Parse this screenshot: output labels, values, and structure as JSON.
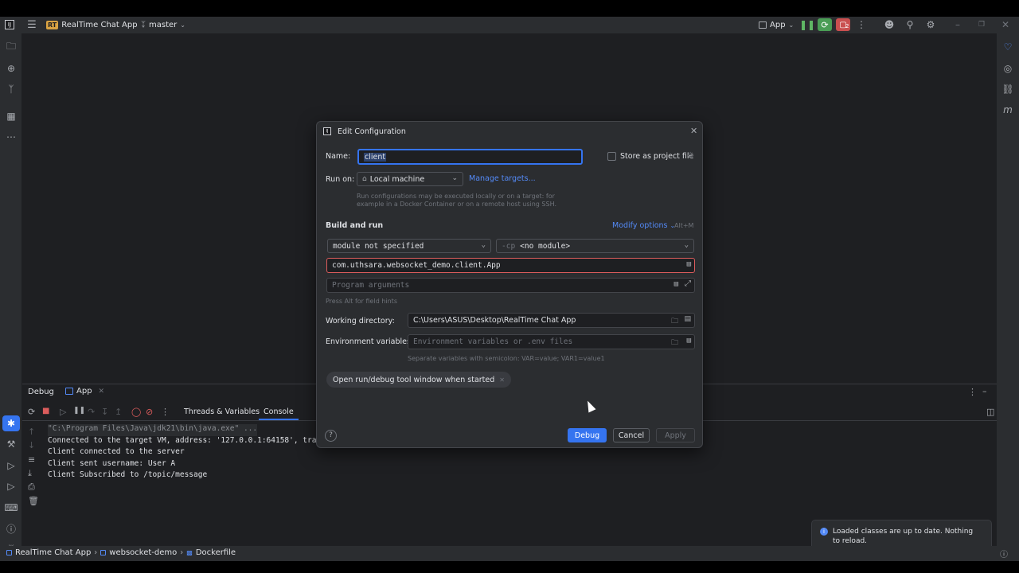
{
  "titlebar": {
    "project_badge": "RT",
    "project_name": "RealTime Chat App",
    "branch": "master",
    "run_config": "App",
    "stop_count": "2"
  },
  "debug_panel": {
    "tab_debug": "Debug",
    "tab_app": "App",
    "tab_threads": "Threads & Variables",
    "tab_console": "Console",
    "console_lines": [
      "\"C:\\Program Files\\Java\\jdk21\\bin\\java.exe\" ...",
      "Connected to the target VM, address: '127.0.0.1:64158', transpo",
      "Client connected to the server",
      "Client sent username: User A",
      "Client Subscribed to /topic/message"
    ]
  },
  "statusbar": {
    "crumbs": [
      "RealTime Chat App",
      "websocket-demo",
      "Dockerfile"
    ]
  },
  "notification": {
    "text": "Loaded classes are up to date. Nothing to reload."
  },
  "dialog": {
    "title": "Edit Configuration",
    "name_label": "Name:",
    "name_value": "client",
    "store_label": "Store as project file",
    "run_on_label": "Run on:",
    "run_on_value": "Local machine",
    "manage_targets": "Manage targets...",
    "run_on_hint_1": "Run configurations may be executed locally or on a target: for",
    "run_on_hint_2": "example in a Docker Container or on a remote host using SSH.",
    "build_run_header": "Build and run",
    "modify_options": "Modify options",
    "modify_shortcut": "Alt+M",
    "module_value": "module not specified",
    "cp_prefix": "-cp",
    "cp_value": "<no module>",
    "main_class": "com.uthsara.websocket_demo.client.App",
    "program_args_placeholder": "Program arguments",
    "field_hints": "Press Alt for field hints",
    "working_dir_label": "Working directory:",
    "working_dir_value": "C:\\Users\\ASUS\\Desktop\\RealTime Chat App",
    "env_label": "Environment variables:",
    "env_placeholder": "Environment variables or .env files",
    "env_hint": "Separate variables with semicolon: VAR=value; VAR1=value1",
    "open_tool_window_chip": "Open run/debug tool window when started",
    "help": "?",
    "debug_button": "Debug",
    "cancel_button": "Cancel",
    "apply_button": "Apply"
  },
  "colors": {
    "accent": "#3574f0",
    "error_border": "#db5c5c",
    "background": "#1e1f22",
    "panel": "#2b2d30"
  }
}
